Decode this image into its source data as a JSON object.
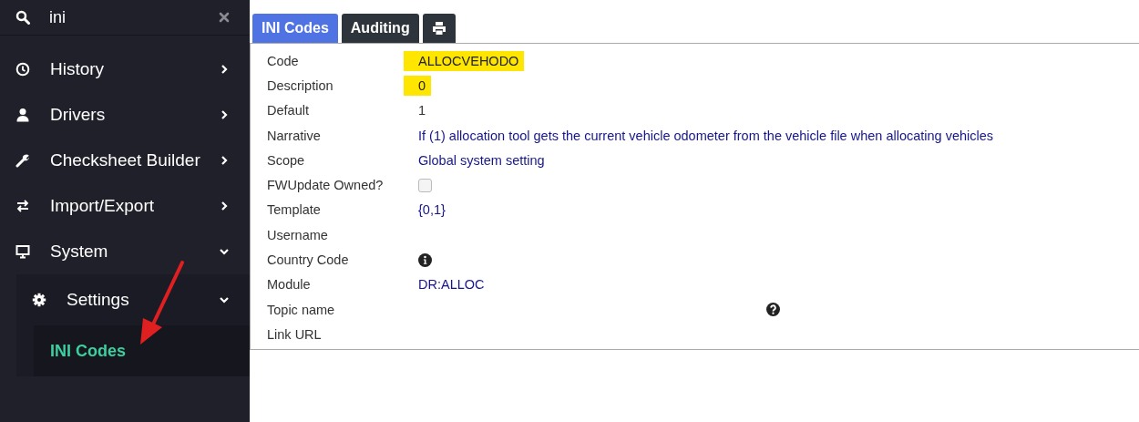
{
  "search": {
    "value": "ini"
  },
  "sidebar": {
    "items": [
      {
        "label": "History",
        "expanded": false
      },
      {
        "label": "Drivers",
        "expanded": false
      },
      {
        "label": "Checksheet Builder",
        "expanded": false
      },
      {
        "label": "Import/Export",
        "expanded": false
      },
      {
        "label": "System",
        "expanded": true,
        "children": [
          {
            "label": "Settings",
            "expanded": true,
            "children": [
              {
                "label": "INI Codes",
                "selected": true
              }
            ]
          }
        ]
      }
    ]
  },
  "tabs": [
    {
      "label": "INI Codes",
      "kind": "text",
      "selected": true
    },
    {
      "label": "Auditing",
      "kind": "text",
      "selected": false
    },
    {
      "kind": "print",
      "selected": false
    }
  ],
  "fields": [
    {
      "label": "Code",
      "kind": "highlight",
      "value": "ALLOCVEHODO"
    },
    {
      "label": "Description",
      "kind": "highlight",
      "value": "0"
    },
    {
      "label": "Default",
      "kind": "text",
      "value": "1"
    },
    {
      "label": "Narrative",
      "kind": "accent",
      "value": "If (1) allocation tool gets the current vehicle odometer from the vehicle file when allocating vehicles"
    },
    {
      "label": "Scope",
      "kind": "accent",
      "value": "Global system setting"
    },
    {
      "label": "FWUpdate Owned?",
      "kind": "checkbox",
      "checked": false
    },
    {
      "label": "Template",
      "kind": "accent",
      "value": "{0,1}"
    },
    {
      "label": "Username",
      "kind": "empty"
    },
    {
      "label": "Country Code",
      "kind": "info"
    },
    {
      "label": "Module",
      "kind": "accent",
      "value": "DR:ALLOC"
    },
    {
      "label": "Topic name",
      "kind": "help"
    },
    {
      "label": "Link URL",
      "kind": "empty"
    }
  ]
}
